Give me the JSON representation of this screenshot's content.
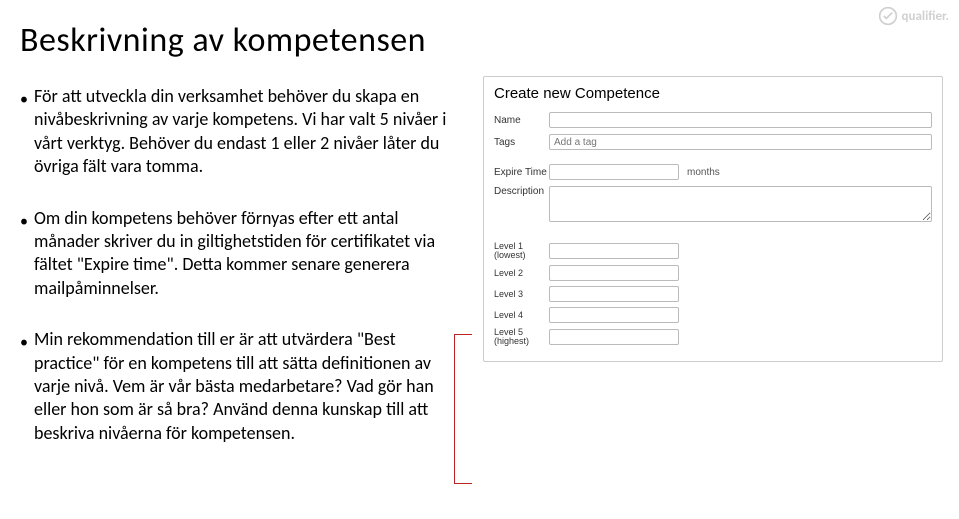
{
  "title": "Beskrivning av kompetensen",
  "bullets": [
    "För att utveckla din verksamhet behöver du skapa en nivåbeskrivning av varje kompetens. Vi har valt 5 nivåer i vårt verktyg. Behöver du endast 1 eller 2 nivåer låter du övriga fält vara tomma.",
    "Om din kompetens behöver förnyas efter ett antal månader skriver du in giltighetstiden för certifikatet via fältet \"Expire time\". Detta kommer senare generera mailpåminnelser.",
    "Min rekommendation till er är att utvärdera \"Best practice\" för en kompetens till att sätta definitionen av varje nivå. Vem är vår bästa medarbetare? Vad gör han eller hon som är så bra? Använd denna kunskap till att beskriva nivåerna för kompetensen."
  ],
  "form": {
    "heading": "Create new Competence",
    "name_label": "Name",
    "tags_label": "Tags",
    "tags_placeholder": "Add a tag",
    "expire_label": "Expire Time",
    "expire_unit": "months",
    "desc_label": "Description",
    "levels": [
      {
        "label": "Level 1 (lowest)"
      },
      {
        "label": "Level 2"
      },
      {
        "label": "Level 3"
      },
      {
        "label": "Level 4"
      },
      {
        "label": "Level 5 (highest)"
      }
    ]
  },
  "brand": "qualifier."
}
